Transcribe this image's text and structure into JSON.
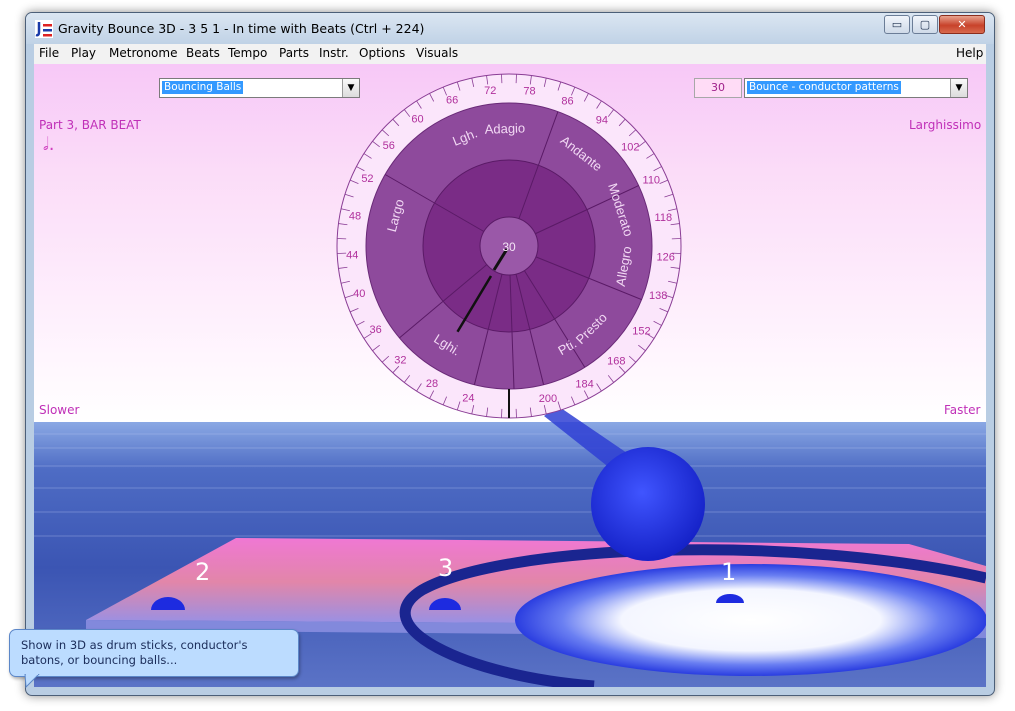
{
  "window": {
    "title": "Gravity Bounce 3D - 3 5 1 - In time with Beats (Ctrl + 224)",
    "controls": {
      "minimize": "▭",
      "maximize": "▢",
      "close": "✕"
    }
  },
  "menu": {
    "items": [
      "File",
      "Play",
      "Metronome",
      "Beats",
      "Tempo",
      "Parts",
      "Instr.",
      "Options",
      "Visuals"
    ],
    "help": "Help"
  },
  "toolbar": {
    "visual_style": "Bouncing Balls",
    "bpm_value": "30",
    "pattern": "Bounce - conductor patterns",
    "dropdown_arrow": "▼"
  },
  "status": {
    "part_beat": "Part 3, BAR BEAT",
    "note_symbol": "𝅗𝅥.",
    "tempo_name": "Larghissimo",
    "slower": "Slower",
    "faster": "Faster"
  },
  "dial": {
    "center_value": "30",
    "tick_labels": [
      "24",
      "28",
      "32",
      "36",
      "40",
      "44",
      "48",
      "52",
      "56",
      "60",
      "66",
      "72",
      "78",
      "86",
      "94",
      "102",
      "110",
      "118",
      "126",
      "138",
      "152",
      "168",
      "184",
      "200"
    ],
    "tempo_words": [
      "Largo",
      "Lgh.",
      "Adagio",
      "Andante",
      "Moderato",
      "Allegro",
      "Presto",
      "Pti.",
      "Lghi."
    ]
  },
  "scene": {
    "beat_labels": [
      "2",
      "3",
      "1"
    ]
  },
  "tooltip": {
    "text": "Show in 3D as drum sticks, conductor's batons, or bouncing balls..."
  },
  "colors": {
    "accent_magenta": "#c030b8",
    "dial_purple": "#8a3d95",
    "ball_blue": "#2233dd",
    "sea_blue": "#3b55b3"
  }
}
